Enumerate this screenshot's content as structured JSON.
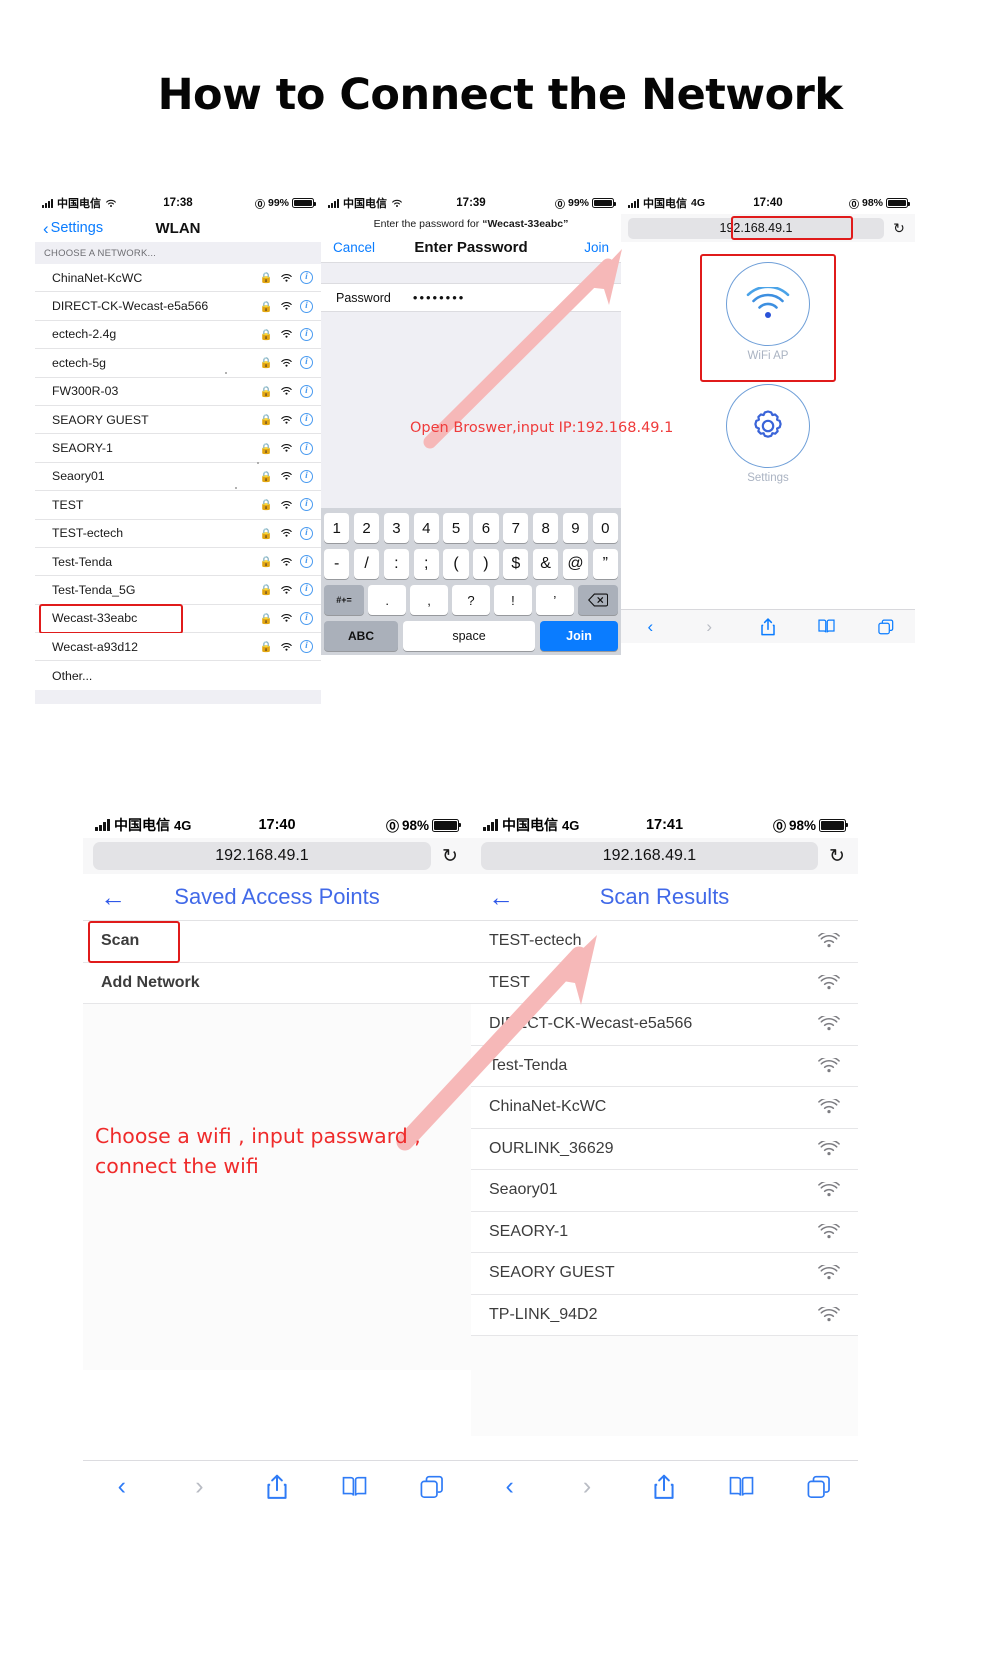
{
  "title": "How to Connect the Network",
  "panel_wlan": {
    "status": {
      "carrier": "中国电信",
      "wifi_icon": "wifi-icon",
      "time": "17:38",
      "battery_pct": "99%",
      "lock_icon": "privacy-icon"
    },
    "back_label": "Settings",
    "nav_title": "WLAN",
    "section_header": "CHOOSE A NETWORK...",
    "networks": [
      {
        "name": "ChinaNet-KcWC"
      },
      {
        "name": "DIRECT-CK-Wecast-e5a566"
      },
      {
        "name": "ectech-2.4g"
      },
      {
        "name": "ectech-5g"
      },
      {
        "name": "FW300R-03"
      },
      {
        "name": "SEAORY GUEST"
      },
      {
        "name": "SEAORY-1"
      },
      {
        "name": "Seaory01"
      },
      {
        "name": "TEST"
      },
      {
        "name": "TEST-ectech"
      },
      {
        "name": "Test-Tenda"
      },
      {
        "name": "Test-Tenda_5G"
      },
      {
        "name": "Wecast-33eabc",
        "highlighted": true
      },
      {
        "name": "Wecast-a93d12"
      }
    ],
    "other_label": "Other..."
  },
  "panel_password": {
    "status": {
      "carrier": "中国电信",
      "time": "17:39",
      "battery_pct": "99%"
    },
    "banner_prefix": "Enter the password for",
    "banner_ssid": "“Wecast-33eabc”",
    "cancel_label": "Cancel",
    "nav_title": "Enter Password",
    "join_label": "Join",
    "field_label": "Password",
    "field_value": "••••••••",
    "keyboard": {
      "row1": [
        "1",
        "2",
        "3",
        "4",
        "5",
        "6",
        "7",
        "8",
        "9",
        "0"
      ],
      "row2": [
        "-",
        "/",
        ":",
        ";",
        "(",
        ")",
        "$",
        "&",
        "@",
        "”"
      ],
      "row3_left": "#+=",
      "row3": [
        ".",
        ",",
        "?",
        "!",
        "’"
      ],
      "row3_delete": "delete-icon",
      "abc_label": "ABC",
      "space_label": "space",
      "join_label": "Join"
    }
  },
  "panel_ap": {
    "status": {
      "carrier": "中国电信",
      "network": "4G",
      "time": "17:40",
      "battery_pct": "98%"
    },
    "url": "192.168.49.1",
    "reload_icon": "reload-icon",
    "tiles": [
      {
        "label": "WiFi AP",
        "icon": "wifi-ap-icon",
        "highlighted": true
      },
      {
        "label": "Settings",
        "icon": "gear-icon",
        "highlighted": false
      }
    ],
    "toolbar": [
      "back-icon",
      "forward-icon",
      "share-icon",
      "bookmarks-icon",
      "tabs-icon"
    ]
  },
  "annotation_top": "Open Broswer,input IP:192.168.49.1",
  "panel_saved": {
    "status": {
      "carrier": "中国电信",
      "network": "4G",
      "time": "17:40",
      "battery_pct": "98%"
    },
    "url": "192.168.49.1",
    "reload_icon": "reload-icon",
    "back_icon": "back-arrow-icon",
    "head_title": "Saved Access Points",
    "rows": [
      {
        "label": "Scan",
        "highlighted": true
      },
      {
        "label": "Add Network",
        "highlighted": false
      }
    ],
    "toolbar": [
      "back-icon",
      "forward-icon",
      "share-icon",
      "bookmarks-icon",
      "tabs-icon"
    ]
  },
  "panel_scan": {
    "status": {
      "carrier": "中国电信",
      "network": "4G",
      "time": "17:41",
      "battery_pct": "98%"
    },
    "url": "192.168.49.1",
    "reload_icon": "reload-icon",
    "back_icon": "back-arrow-icon",
    "head_title": "Scan Results",
    "results": [
      "TEST-ectech",
      "TEST",
      "DIRECT-CK-Wecast-e5a566",
      "Test-Tenda",
      "ChinaNet-KcWC",
      "OURLINK_36629",
      "Seaory01",
      "SEAORY-1",
      "SEAORY GUEST",
      "TP-LINK_94D2"
    ],
    "toolbar": [
      "back-icon",
      "forward-icon",
      "share-icon",
      "bookmarks-icon",
      "tabs-icon"
    ]
  },
  "annotation_bottom_line1": "Choose a wifi , input passward ,",
  "annotation_bottom_line2": "connect the wifi",
  "colors": {
    "highlight_red": "#e01b1b",
    "annotation_red": "#ef3b3b",
    "ios_blue": "#0a7cff",
    "link_blue": "#4169e8",
    "arrow_pink": "#f6b8b8"
  }
}
